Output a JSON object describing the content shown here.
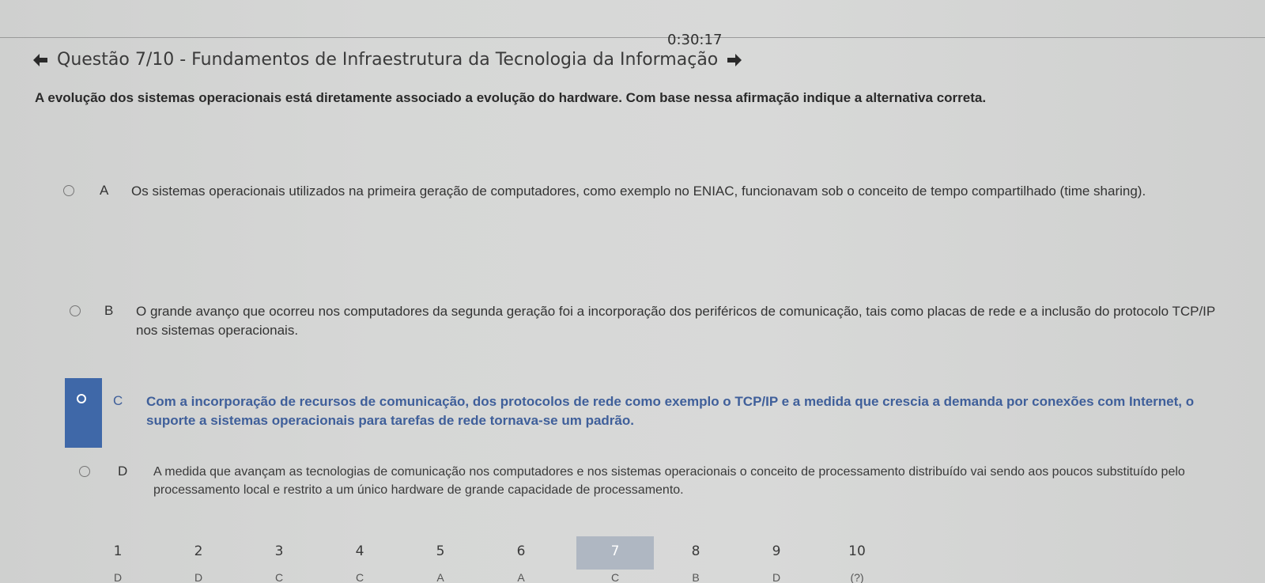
{
  "header": {
    "timer": "0:30:17",
    "title": "Questão 7/10 - Fundamentos de Infraestrutura da Tecnologia da Informação",
    "prev_icon": "arrow-left-icon",
    "next_icon": "arrow-right-icon"
  },
  "question": {
    "statement": "A evolução dos sistemas operacionais está diretamente associado a evolução do hardware. Com base nessa afirmação indique a alternativa correta."
  },
  "options": [
    {
      "letter": "A",
      "text": "Os sistemas operacionais utilizados na primeira geração de computadores, como exemplo no ENIAC, funcionavam sob o conceito de tempo compartilhado (time sharing).",
      "selected": false
    },
    {
      "letter": "B",
      "text": "O grande avanço que ocorreu nos computadores da segunda geração foi a incorporação dos periféricos de comunicação, tais como placas de rede e a inclusão do protocolo TCP/IP nos sistemas operacionais.",
      "selected": false
    },
    {
      "letter": "C",
      "text": "Com a incorporação de recursos de comunicação, dos protocolos de rede como exemplo o TCP/IP e a medida que crescia a demanda por conexões com Internet, o suporte a sistemas operacionais para tarefas de rede tornava-se um padrão.",
      "selected": true
    },
    {
      "letter": "D",
      "text": "A medida que avançam as tecnologias de comunicação nos computadores e nos sistemas operacionais o conceito de processamento distribuído vai sendo aos poucos substituído pelo processamento local e restrito a um único hardware de grande capacidade de processamento.",
      "selected": false
    }
  ],
  "pager": {
    "pages": [
      "1",
      "2",
      "3",
      "4",
      "5",
      "6",
      "7",
      "8",
      "9",
      "10"
    ],
    "current": "7",
    "answers": [
      "D",
      "D",
      "C",
      "C",
      "A",
      "A",
      "C",
      "B",
      "D",
      "(?)"
    ]
  },
  "colors": {
    "accent": "#3f68a8",
    "selected_text": "#3f5f9a",
    "current_page_bg": "#afb7c2"
  }
}
